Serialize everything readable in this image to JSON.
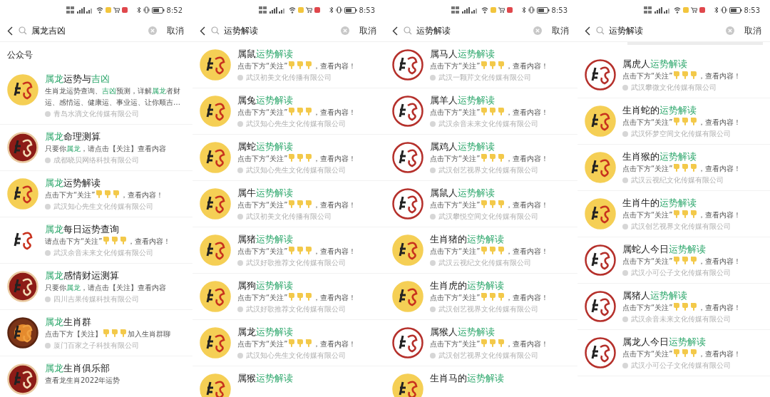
{
  "panels": [
    {
      "status_bar": {
        "time": "8:52"
      },
      "search": {
        "query": "属龙吉凶",
        "cancel": "取消"
      },
      "section_label": "公众号",
      "partial_row_above": false,
      "rows": [
        {
          "kind": "yellow",
          "title": [
            {
              "text": "属龙",
              "hit": true
            },
            {
              "text": "运势与",
              "hit": false
            },
            {
              "text": "吉凶",
              "hit": true
            }
          ],
          "desc": [
            {
              "kind": "text",
              "text": "生肖龙运势查询、",
              "hit": false
            },
            {
              "kind": "text",
              "text": "吉凶",
              "hit": true
            },
            {
              "kind": "text",
              "text": "预测，详解",
              "hit": false
            },
            {
              "kind": "text",
              "text": "属龙",
              "hit": true
            },
            {
              "kind": "text",
              "text": "者财运、感情运、健康运、事业运、让你顺吉…",
              "hit": false
            }
          ],
          "company": "青岛水滴文化传媒有限公司"
        },
        {
          "kind": "dark-red",
          "title": [
            {
              "text": "属龙",
              "hit": true
            },
            {
              "text": "命理测算",
              "hit": false
            }
          ],
          "desc": [
            {
              "kind": "text",
              "text": "只要你",
              "hit": false
            },
            {
              "kind": "text",
              "text": "属龙",
              "hit": true
            },
            {
              "kind": "text",
              "text": "，请点击【关注】查看内容",
              "hit": false
            }
          ],
          "company": "成都晓贝网络科技有限公司"
        },
        {
          "kind": "yellow",
          "title": [
            {
              "text": "属龙",
              "hit": true
            },
            {
              "text": "运势解读",
              "hit": false
            }
          ],
          "desc": [
            {
              "kind": "text",
              "text": "点击下方“关注”",
              "hit": false
            },
            {
              "kind": "hand"
            },
            {
              "kind": "hand"
            },
            {
              "kind": "hand"
            },
            {
              "kind": "text",
              "text": "，查看内容！",
              "hit": false
            }
          ],
          "company": "武汉知心先生文化传媒有限公司"
        },
        {
          "kind": "white",
          "title": [
            {
              "text": "属龙",
              "hit": true
            },
            {
              "text": "每日运势查询",
              "hit": false
            }
          ],
          "desc": [
            {
              "kind": "text",
              "text": "请点击下方“关注”",
              "hit": false
            },
            {
              "kind": "hand"
            },
            {
              "kind": "hand"
            },
            {
              "kind": "hand"
            },
            {
              "kind": "text",
              "text": "，查看内容！",
              "hit": false
            }
          ],
          "company": "武汉余音未来文化传媒有限公司"
        },
        {
          "kind": "dark-red",
          "title": [
            {
              "text": "属龙",
              "hit": true
            },
            {
              "text": "感情财运测算",
              "hit": false
            }
          ],
          "desc": [
            {
              "kind": "text",
              "text": "只要你",
              "hit": false
            },
            {
              "kind": "text",
              "text": "属龙",
              "hit": true
            },
            {
              "kind": "text",
              "text": "，请点击【关注】查看内容",
              "hit": false
            }
          ],
          "company": "四川吉果传媒科技有限公司"
        },
        {
          "kind": "wheel",
          "title": [
            {
              "text": "属龙",
              "hit": true
            },
            {
              "text": "生肖群",
              "hit": false
            }
          ],
          "desc": [
            {
              "kind": "text",
              "text": "点击下方【关注】",
              "hit": false
            },
            {
              "kind": "hand"
            },
            {
              "kind": "hand"
            },
            {
              "kind": "hand"
            },
            {
              "kind": "text",
              "text": "加入生肖群聊",
              "hit": false
            }
          ],
          "company": "厦门百家之子科技有限公司"
        },
        {
          "kind": "dark-red",
          "title": [
            {
              "text": "属龙",
              "hit": true
            },
            {
              "text": "生肖俱乐部",
              "hit": false
            }
          ],
          "desc": [
            {
              "kind": "text",
              "text": "查看龙生肖2022年运势",
              "hit": false
            }
          ]
        }
      ]
    },
    {
      "status_bar": {
        "time": "8:53"
      },
      "search": {
        "query": "运势解读",
        "cancel": "取消"
      },
      "partial_row_above": false,
      "rows": [
        {
          "kind": "yellow",
          "title": [
            {
              "text": "属鼠",
              "hit": false
            },
            {
              "text": "运势解读",
              "hit": true
            }
          ],
          "desc": [
            {
              "kind": "text",
              "text": "点击下方“关注”",
              "hit": false
            },
            {
              "kind": "hand"
            },
            {
              "kind": "hand"
            },
            {
              "kind": "hand"
            },
            {
              "kind": "text",
              "text": "，查看内容！",
              "hit": false
            }
          ],
          "company": "武汉初美文化传播有限公司"
        },
        {
          "kind": "yellow",
          "title": [
            {
              "text": "属兔",
              "hit": false
            },
            {
              "text": "运势解读",
              "hit": true
            }
          ],
          "desc": [
            {
              "kind": "text",
              "text": "点击下方“关注”",
              "hit": false
            },
            {
              "kind": "hand"
            },
            {
              "kind": "hand"
            },
            {
              "kind": "hand"
            },
            {
              "kind": "text",
              "text": "，查看内容！",
              "hit": false
            }
          ],
          "company": "武汉知心先生文化传媒有限公司"
        },
        {
          "kind": "yellow",
          "title": [
            {
              "text": "属蛇",
              "hit": false
            },
            {
              "text": "运势解读",
              "hit": true
            }
          ],
          "desc": [
            {
              "kind": "text",
              "text": "点击下方“关注”",
              "hit": false
            },
            {
              "kind": "hand"
            },
            {
              "kind": "hand"
            },
            {
              "kind": "hand"
            },
            {
              "kind": "text",
              "text": "，查看内容！",
              "hit": false
            }
          ],
          "company": "武汉知心先生文化传媒有限公司"
        },
        {
          "kind": "yellow",
          "title": [
            {
              "text": "属牛",
              "hit": false
            },
            {
              "text": "运势解读",
              "hit": true
            }
          ],
          "desc": [
            {
              "kind": "text",
              "text": "点击下方“关注”",
              "hit": false
            },
            {
              "kind": "hand"
            },
            {
              "kind": "hand"
            },
            {
              "kind": "hand"
            },
            {
              "kind": "text",
              "text": "，查看内容！",
              "hit": false
            }
          ],
          "company": "武汉初美文化传播有限公司"
        },
        {
          "kind": "yellow",
          "title": [
            {
              "text": "属猪",
              "hit": false
            },
            {
              "text": "运势解读",
              "hit": true
            }
          ],
          "desc": [
            {
              "kind": "text",
              "text": "点击下方“关注”",
              "hit": false
            },
            {
              "kind": "hand"
            },
            {
              "kind": "hand"
            },
            {
              "kind": "hand"
            },
            {
              "kind": "text",
              "text": "，查看内容！",
              "hit": false
            }
          ],
          "company": "武汉好歌推荐文化传媒有限公司"
        },
        {
          "kind": "yellow",
          "title": [
            {
              "text": "属狗",
              "hit": false
            },
            {
              "text": "运势解读",
              "hit": true
            }
          ],
          "desc": [
            {
              "kind": "text",
              "text": "点击下方“关注”",
              "hit": false
            },
            {
              "kind": "hand"
            },
            {
              "kind": "hand"
            },
            {
              "kind": "hand"
            },
            {
              "kind": "text",
              "text": "，查看内容！",
              "hit": false
            }
          ],
          "company": "武汉好歌推荐文化传媒有限公司"
        },
        {
          "kind": "yellow",
          "title": [
            {
              "text": "属龙",
              "hit": false
            },
            {
              "text": "运势解读",
              "hit": true
            }
          ],
          "desc": [
            {
              "kind": "text",
              "text": "点击下方“关注”",
              "hit": false
            },
            {
              "kind": "hand"
            },
            {
              "kind": "hand"
            },
            {
              "kind": "hand"
            },
            {
              "kind": "text",
              "text": "，查看内容！",
              "hit": false
            }
          ],
          "company": "武汉知心先生文化传媒有限公司"
        },
        {
          "kind": "yellow",
          "title": [
            {
              "text": "属猴",
              "hit": false
            },
            {
              "text": "运势解读",
              "hit": true
            }
          ]
        }
      ]
    },
    {
      "status_bar": {
        "time": "8:53"
      },
      "search": {
        "query": "运势解读",
        "cancel": "取消"
      },
      "partial_row_above": false,
      "rows": [
        {
          "kind": "ring",
          "title": [
            {
              "text": "属马人",
              "hit": false
            },
            {
              "text": "运势解读",
              "hit": true
            }
          ],
          "desc": [
            {
              "kind": "text",
              "text": "点击下方“关注”",
              "hit": false
            },
            {
              "kind": "hand"
            },
            {
              "kind": "hand"
            },
            {
              "kind": "hand"
            },
            {
              "kind": "text",
              "text": "，查看内容！",
              "hit": false
            }
          ],
          "company": "武汉一颗芹文化传媒有限公司"
        },
        {
          "kind": "ring",
          "title": [
            {
              "text": "属羊人",
              "hit": false
            },
            {
              "text": "运势解读",
              "hit": true
            }
          ],
          "desc": [
            {
              "kind": "text",
              "text": "点击下方“关注”",
              "hit": false
            },
            {
              "kind": "hand"
            },
            {
              "kind": "hand"
            },
            {
              "kind": "hand"
            },
            {
              "kind": "text",
              "text": "，查看内容！",
              "hit": false
            }
          ],
          "company": "武汉余音未来文化传媒有限公司"
        },
        {
          "kind": "ring",
          "title": [
            {
              "text": "属鸡人",
              "hit": false
            },
            {
              "text": "运势解读",
              "hit": true
            }
          ],
          "desc": [
            {
              "kind": "text",
              "text": "点击下方“关注”",
              "hit": false
            },
            {
              "kind": "hand"
            },
            {
              "kind": "hand"
            },
            {
              "kind": "hand"
            },
            {
              "kind": "text",
              "text": "，查看内容！",
              "hit": false
            }
          ],
          "company": "武汉创艺视界文化传媒有限公司"
        },
        {
          "kind": "ring",
          "title": [
            {
              "text": "属鼠人",
              "hit": false
            },
            {
              "text": "运势解读",
              "hit": true
            }
          ],
          "desc": [
            {
              "kind": "text",
              "text": "点击下方“关注”",
              "hit": false
            },
            {
              "kind": "hand"
            },
            {
              "kind": "hand"
            },
            {
              "kind": "hand"
            },
            {
              "kind": "text",
              "text": "，查看内容！",
              "hit": false
            }
          ],
          "company": "武汉攀悦空间文化传媒有限公司"
        },
        {
          "kind": "yellow",
          "title": [
            {
              "text": "生肖猪的",
              "hit": false
            },
            {
              "text": "运势解读",
              "hit": true
            }
          ],
          "desc": [
            {
              "kind": "text",
              "text": "点击下方“关注”",
              "hit": false
            },
            {
              "kind": "hand"
            },
            {
              "kind": "hand"
            },
            {
              "kind": "hand"
            },
            {
              "kind": "text",
              "text": "，查看内容！",
              "hit": false
            }
          ],
          "company": "武汉云视纪文化传媒有限公司"
        },
        {
          "kind": "yellow",
          "title": [
            {
              "text": "生肖虎的",
              "hit": false
            },
            {
              "text": "运势解读",
              "hit": true
            }
          ],
          "desc": [
            {
              "kind": "text",
              "text": "点击下方“关注”",
              "hit": false
            },
            {
              "kind": "hand"
            },
            {
              "kind": "hand"
            },
            {
              "kind": "hand"
            },
            {
              "kind": "text",
              "text": "，查看内容！",
              "hit": false
            }
          ],
          "company": "武汉创艺视界文化传媒有限公司"
        },
        {
          "kind": "ring",
          "title": [
            {
              "text": "属猴人",
              "hit": false
            },
            {
              "text": "运势解读",
              "hit": true
            }
          ],
          "desc": [
            {
              "kind": "text",
              "text": "点击下方“关注”",
              "hit": false
            },
            {
              "kind": "hand"
            },
            {
              "kind": "hand"
            },
            {
              "kind": "hand"
            },
            {
              "kind": "text",
              "text": "，查看内容！",
              "hit": false
            }
          ],
          "company": "武汉创艺视界文化传媒有限公司"
        },
        {
          "kind": "yellow",
          "title": [
            {
              "text": "生肖马的",
              "hit": false
            },
            {
              "text": "运势解读",
              "hit": true
            }
          ]
        }
      ]
    },
    {
      "status_bar": {
        "time": "8:53"
      },
      "search": {
        "query": "运势解读",
        "cancel": "取消"
      },
      "partial_row_above": true,
      "rows": [
        {
          "kind": "ring",
          "title": [
            {
              "text": "属虎人",
              "hit": false
            },
            {
              "text": "运势解读",
              "hit": true
            }
          ],
          "desc": [
            {
              "kind": "text",
              "text": "点击下方“关注”",
              "hit": false
            },
            {
              "kind": "hand"
            },
            {
              "kind": "hand"
            },
            {
              "kind": "hand"
            },
            {
              "kind": "text",
              "text": "，查看内容！",
              "hit": false
            }
          ],
          "company": "武汉攀微文化传媒有限公司"
        },
        {
          "kind": "yellow",
          "title": [
            {
              "text": "生肖蛇的",
              "hit": false
            },
            {
              "text": "运势解读",
              "hit": true
            }
          ],
          "desc": [
            {
              "kind": "text",
              "text": "点击下方“关注”",
              "hit": false
            },
            {
              "kind": "hand"
            },
            {
              "kind": "hand"
            },
            {
              "kind": "hand"
            },
            {
              "kind": "text",
              "text": "，查看内容！",
              "hit": false
            }
          ],
          "company": "武汉怀梦空间文化传媒有限公司"
        },
        {
          "kind": "yellow",
          "title": [
            {
              "text": "生肖猴的",
              "hit": false
            },
            {
              "text": "运势解读",
              "hit": true
            }
          ],
          "desc": [
            {
              "kind": "text",
              "text": "点击下方“关注”",
              "hit": false
            },
            {
              "kind": "hand"
            },
            {
              "kind": "hand"
            },
            {
              "kind": "hand"
            },
            {
              "kind": "text",
              "text": "，查看内容！",
              "hit": false
            }
          ],
          "company": "武汉云视纪文化传媒有限公司"
        },
        {
          "kind": "yellow",
          "title": [
            {
              "text": "生肖牛的",
              "hit": false
            },
            {
              "text": "运势解读",
              "hit": true
            }
          ],
          "desc": [
            {
              "kind": "text",
              "text": "点击下方“关注”",
              "hit": false
            },
            {
              "kind": "hand"
            },
            {
              "kind": "hand"
            },
            {
              "kind": "hand"
            },
            {
              "kind": "text",
              "text": "，查看内容！",
              "hit": false
            }
          ],
          "company": "武汉创艺视界文化传媒有限公司"
        },
        {
          "kind": "ring",
          "title": [
            {
              "text": "属蛇人今日",
              "hit": false
            },
            {
              "text": "运势解读",
              "hit": true
            }
          ],
          "desc": [
            {
              "kind": "text",
              "text": "点击下方“关注”",
              "hit": false
            },
            {
              "kind": "hand"
            },
            {
              "kind": "hand"
            },
            {
              "kind": "hand"
            },
            {
              "kind": "text",
              "text": "，查看内容！",
              "hit": false
            }
          ],
          "company": "武汉小可公子文化传媒有限公司"
        },
        {
          "kind": "ring",
          "title": [
            {
              "text": "属猪人",
              "hit": false
            },
            {
              "text": "运势解读",
              "hit": true
            }
          ],
          "desc": [
            {
              "kind": "text",
              "text": "点击下方“关注”",
              "hit": false
            },
            {
              "kind": "hand"
            },
            {
              "kind": "hand"
            },
            {
              "kind": "hand"
            },
            {
              "kind": "text",
              "text": "，查看内容！",
              "hit": false
            }
          ],
          "company": "武汉余音未来文化传媒有限公司"
        },
        {
          "kind": "ring",
          "title": [
            {
              "text": "属龙人今日",
              "hit": false
            },
            {
              "text": "运势解读",
              "hit": true
            }
          ],
          "desc": [
            {
              "kind": "text",
              "text": "点击下方“关注”",
              "hit": false
            },
            {
              "kind": "hand"
            },
            {
              "kind": "hand"
            },
            {
              "kind": "hand"
            },
            {
              "kind": "text",
              "text": "，查看内容！",
              "hit": false
            }
          ],
          "company": "武汉小可公子文化传媒有限公司"
        }
      ]
    }
  ]
}
